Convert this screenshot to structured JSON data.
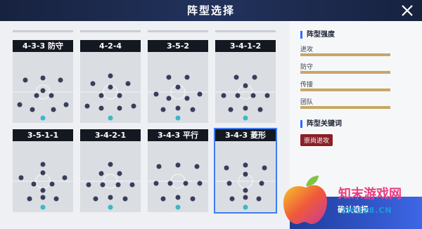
{
  "header": {
    "title": "阵型选择",
    "close_icon": "close-icon"
  },
  "formations": [
    {
      "name": "4-3-3 防守",
      "selected": false
    },
    {
      "name": "4-2-4",
      "selected": false
    },
    {
      "name": "3-5-2",
      "selected": false
    },
    {
      "name": "3-4-1-2",
      "selected": false
    },
    {
      "name": "3-5-1-1",
      "selected": false
    },
    {
      "name": "3-4-2-1",
      "selected": false
    },
    {
      "name": "3-4-3 平行",
      "selected": false
    },
    {
      "name": "3-4-3 菱形",
      "selected": true
    }
  ],
  "sidebar": {
    "strength_title": "阵型强度",
    "stats": [
      {
        "label": "进攻"
      },
      {
        "label": "防守"
      },
      {
        "label": "传接"
      },
      {
        "label": "团队"
      }
    ],
    "keyword_title": "阵型关键词",
    "keyword_tag": "崇尚进攻"
  },
  "confirm": {
    "label": "确认选择"
  },
  "watermark": {
    "text_cn": "知末游戏网",
    "text_en": "ZMU28.CN"
  },
  "colors": {
    "accent": "#2f6bff",
    "player_dot": "#3a3d5a",
    "goalkeeper_dot": "#39b9c9",
    "stat_bar": "#c7a766",
    "tag_bg": "#8a1f26"
  }
}
